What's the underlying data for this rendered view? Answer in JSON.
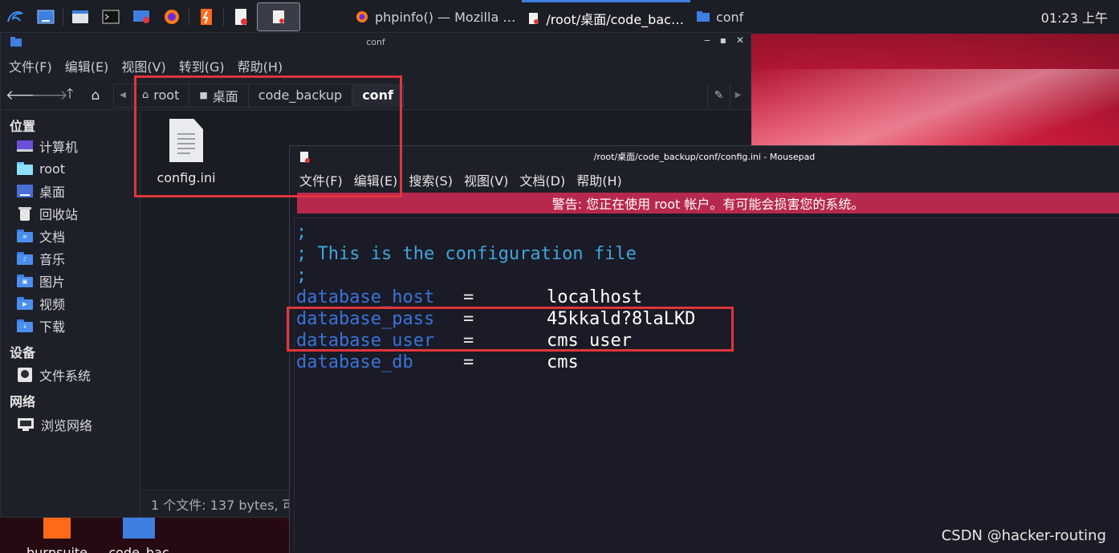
{
  "taskbar": {
    "tasks": [
      {
        "label": "phpinfo() — Mozilla …",
        "icon": "firefox-icon"
      },
      {
        "label": "/root/桌面/code_bac…",
        "icon": "mousepad-icon"
      },
      {
        "label": "conf",
        "icon": "folder-icon"
      }
    ],
    "clock": "01:23 上午"
  },
  "file_manager": {
    "title": "conf",
    "menu": [
      "文件(F)",
      "编辑(E)",
      "视图(V)",
      "转到(G)",
      "帮助(H)"
    ],
    "breadcrumbs": [
      "root",
      "桌面",
      "code_backup",
      "conf"
    ],
    "sidebar": {
      "places_heading": "位置",
      "places": [
        "计算机",
        "root",
        "桌面",
        "回收站",
        "文档",
        "音乐",
        "图片",
        "视频",
        "下载"
      ],
      "devices_heading": "设备",
      "devices": [
        "文件系统"
      ],
      "network_heading": "网络",
      "network": [
        "浏览网络"
      ]
    },
    "file": "config.ini",
    "status": "1 个文件: 137 bytes, 可"
  },
  "desktop_icons": [
    "burpsuite",
    "code_bac"
  ],
  "editor": {
    "title": "/root/桌面/code_backup/conf/config.ini - Mousepad",
    "menu": [
      "文件(F)",
      "编辑(E)",
      "搜索(S)",
      "视图(V)",
      "文档(D)",
      "帮助(H)"
    ],
    "warning": "警告: 您正在使用 root 帐户。有可能会损害您的系统。",
    "comments": [
      ";",
      "; This is the configuration file",
      ";"
    ],
    "config": [
      {
        "key": "database_host",
        "eq": "=",
        "value": "localhost"
      },
      {
        "key": "database_pass",
        "eq": "=",
        "value": "45kkald?8laLKD"
      },
      {
        "key": "database_user",
        "eq": "=",
        "value": "cms_user"
      },
      {
        "key": "database_db",
        "eq": "=",
        "value": "cms"
      }
    ]
  },
  "watermark": "CSDN @hacker-routing",
  "colors": {
    "highlight": "#e0353a",
    "warning_bg": "#b7294c",
    "key": "#3b73d8",
    "comment": "#3fa6d9"
  }
}
